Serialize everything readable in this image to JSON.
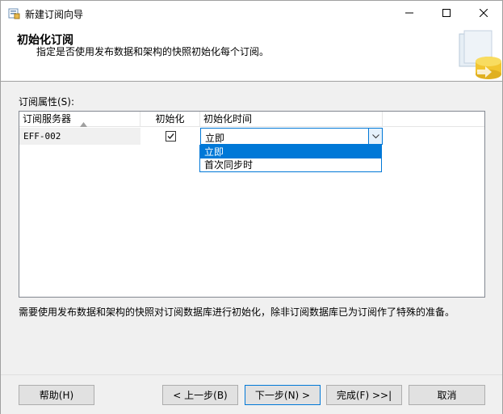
{
  "window": {
    "title": "新建订阅向导"
  },
  "header": {
    "title": "初始化订阅",
    "subtitle": "指定是否使用发布数据和架构的快照初始化每个订阅。"
  },
  "grid": {
    "label": "订阅属性(S):",
    "columns": [
      "订阅服务器",
      "初始化",
      "初始化时间"
    ],
    "rows": [
      {
        "server": "EFF-002",
        "initialize": true,
        "init_time": "立即"
      }
    ]
  },
  "dropdown": {
    "options": [
      "立即",
      "首次同步时"
    ],
    "selected_index": 0
  },
  "description": "需要使用发布数据和架构的快照对订阅数据库进行初始化，除非订阅数据库已为订阅作了特殊的准备。",
  "buttons": {
    "help": "帮助(H)",
    "back": "< 上一步(B)",
    "next": "下一步(N) >",
    "finish": "完成(F) >>|",
    "cancel": "取消"
  },
  "colors": {
    "accent": "#0078d7",
    "header_bg": "#ffffff",
    "dialog_bg": "#f0f0f0"
  }
}
